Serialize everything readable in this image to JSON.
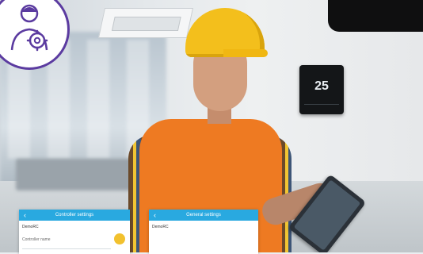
{
  "scene": {
    "thermostat": {
      "temperature": "25"
    }
  },
  "screens": [
    {
      "title": "Controller settings",
      "device": "DemoRC",
      "field_label": "Controller name"
    },
    {
      "title": "General settings",
      "device": "DemoRC"
    }
  ],
  "colors": {
    "app_bar": "#29a9e0",
    "badge_outline": "#5b3ba0",
    "vest": "#ee7a22",
    "helmet": "#f3bf1c"
  },
  "icons": {
    "badge": "engineer-gear-icon",
    "back": "back-chevron-icon",
    "fab": "action-circle-icon"
  }
}
